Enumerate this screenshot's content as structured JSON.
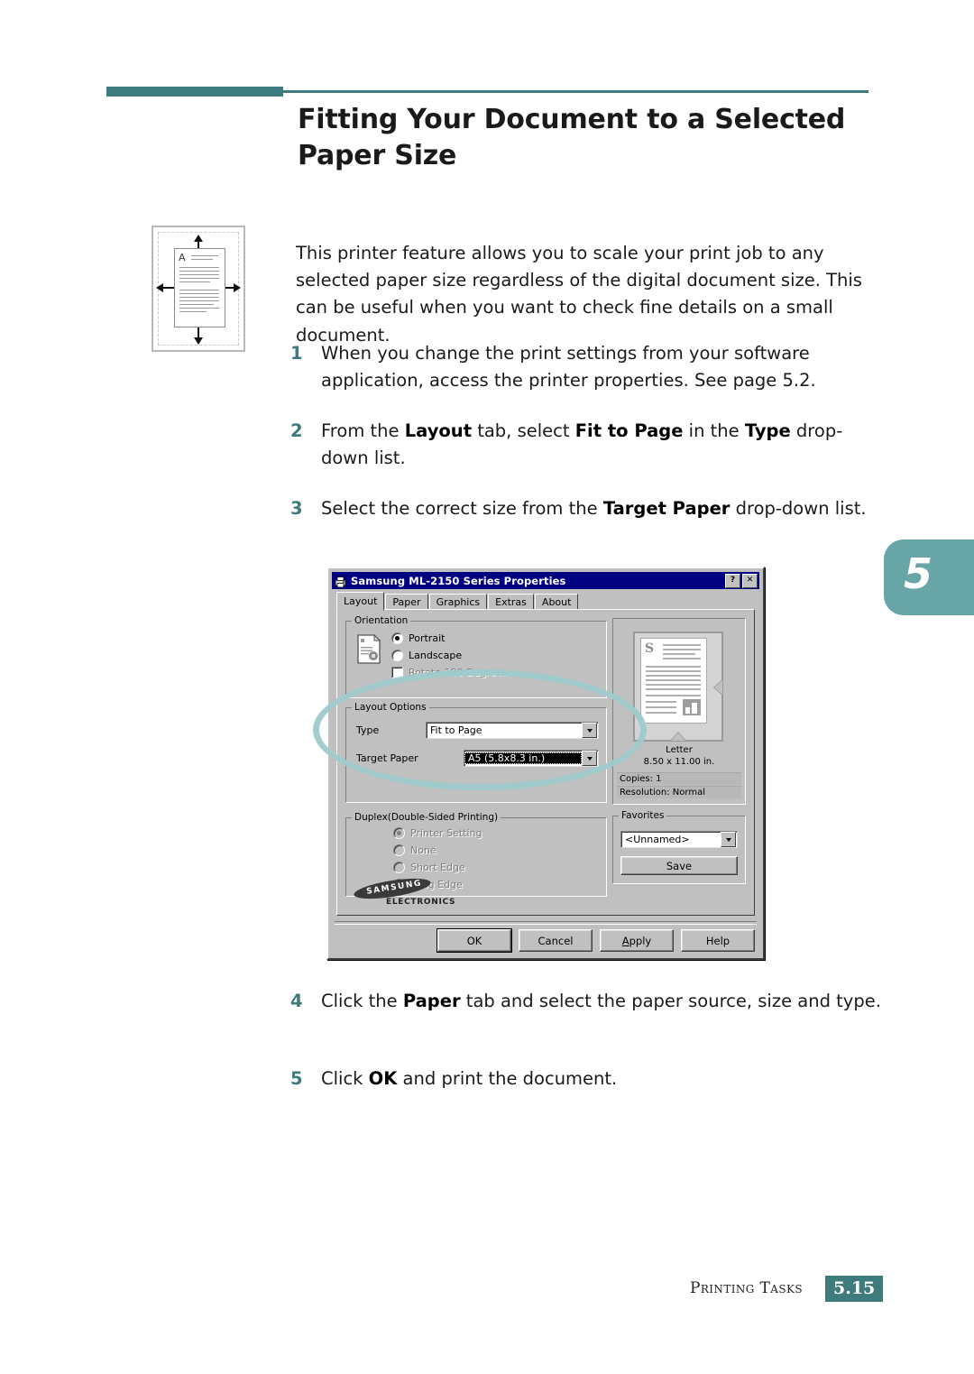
{
  "document": {
    "title_line1": "Fitting Your Document to a Selected",
    "title_line2": "Paper Size",
    "intro": "This printer feature allows you to scale your print job to any selected paper size regardless of the digital document size. This can be useful when you want to check fine details on a small document.",
    "chapter_tab": "5",
    "footer_label": "Printing Tasks",
    "page_number": "5.15",
    "accent_color": "#3f7a7c",
    "tab_color": "#68a5a6",
    "highlight_color": "#9ecacb"
  },
  "illustration": {
    "name": "fit-to-page-diagram",
    "page_letter": "A"
  },
  "steps": [
    {
      "num": "1",
      "text_html": "When you change the print settings from your software application, access the printer properties. See page 5.2."
    },
    {
      "num": "2",
      "text_html": "From the <b>Layout</b> tab, select <b>Fit to Page</b> in the <b>Type</b> drop-down list."
    },
    {
      "num": "3",
      "text_html": "Select the correct size from the <b>Target Paper</b> drop-down list."
    },
    {
      "num": "4",
      "text_html": "Click the <b>Paper</b> tab and select the paper source, size and type."
    },
    {
      "num": "5",
      "text_html": "Click <b>OK</b> and print the document."
    }
  ],
  "dialog": {
    "title": "Samsung ML-2150 Series Properties",
    "titlebar_buttons": [
      "?",
      "✕"
    ],
    "tabs": [
      {
        "label": "Layout",
        "active": true
      },
      {
        "label": "Paper",
        "active": false
      },
      {
        "label": "Graphics",
        "active": false
      },
      {
        "label": "Extras",
        "active": false
      },
      {
        "label": "About",
        "active": false
      }
    ],
    "orientation": {
      "group_label": "Orientation",
      "options": [
        {
          "label": "Portrait",
          "selected": true,
          "disabled": false
        },
        {
          "label": "Landscape",
          "selected": false,
          "disabled": false
        }
      ],
      "checkbox": {
        "label": "Rotate 180 Degrees",
        "checked": false,
        "disabled": true
      }
    },
    "layout_options": {
      "group_label": "Layout Options",
      "type_label": "Type",
      "type_value": "Fit to Page",
      "target_paper_label": "Target Paper",
      "target_paper_value": "A5 (5.8x8.3 in.)"
    },
    "duplex": {
      "group_label": "Duplex(Double-Sided Printing)",
      "options": [
        {
          "label": "Printer Setting",
          "selected": true,
          "disabled": true
        },
        {
          "label": "None",
          "selected": false,
          "disabled": true
        },
        {
          "label": "Short Edge",
          "selected": false,
          "disabled": true
        },
        {
          "label": "Long Edge",
          "selected": false,
          "disabled": true
        }
      ]
    },
    "preview": {
      "paper_name": "Letter",
      "paper_dims": "8.50 x 11.00 in.",
      "copies": "Copies: 1",
      "resolution": "Resolution: Normal",
      "doc_letter": "S"
    },
    "favorites": {
      "group_label": "Favorites",
      "value": "<Unnamed>",
      "save_button": "Save"
    },
    "brand": {
      "name": "SAMSUNG",
      "sub": "ELECTRONICS"
    },
    "buttons": [
      {
        "label": "OK",
        "default": true
      },
      {
        "label": "Cancel",
        "default": false
      },
      {
        "label": "Apply",
        "default": false,
        "accesskey": "A"
      },
      {
        "label": "Help",
        "default": false
      }
    ]
  }
}
